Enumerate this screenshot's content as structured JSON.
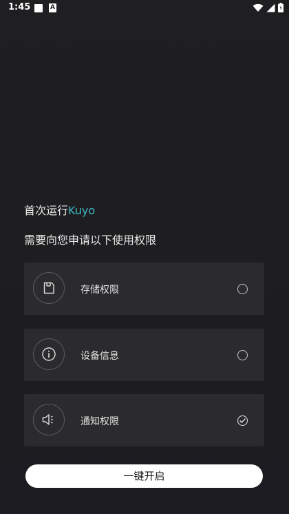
{
  "status_bar": {
    "time": "1:45",
    "notification_a": "A",
    "icons": [
      "notification-square-icon",
      "notification-a-icon",
      "wifi-icon",
      "signal-icon",
      "battery-icon"
    ]
  },
  "intro": {
    "heading_prefix": "首次运行",
    "app_name": "Kuyo",
    "subheading": "需要向您申请以下使用权限"
  },
  "permissions": [
    {
      "icon": "storage-icon",
      "label": "存储权限",
      "checked": false
    },
    {
      "icon": "info-icon",
      "label": "设备信息",
      "checked": false
    },
    {
      "icon": "speaker-icon",
      "label": "通知权限",
      "checked": true
    }
  ],
  "enable_button": {
    "label": "一键开启"
  },
  "colors": {
    "background": "#1f1f21",
    "card": "#2b2b2e",
    "accent": "#3fb9c9",
    "button": "#ffffff"
  }
}
